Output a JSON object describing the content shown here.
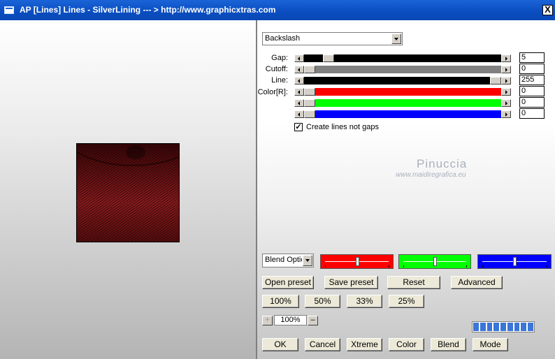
{
  "window": {
    "title": "AP [Lines]  Lines - SilverLining     --- > http://www.graphicxtras.com",
    "close_label": "X"
  },
  "mode_select": {
    "value": "Backslash"
  },
  "sliders": [
    {
      "label": "Gap:",
      "value": "5",
      "level": 0.1,
      "color": "#000000"
    },
    {
      "label": "Cutoff:",
      "value": "0",
      "level": 0.0,
      "color": "#808080"
    },
    {
      "label": "Line:",
      "value": "255",
      "level": 1.0,
      "color": "#000000"
    },
    {
      "label": "Color[R]:",
      "value": "0",
      "level": 0.0,
      "color": "#ff0000"
    },
    {
      "label": "",
      "value": "0",
      "level": 0.0,
      "color": "#00ff00"
    },
    {
      "label": "",
      "value": "0",
      "level": 0.0,
      "color": "#0000ff"
    }
  ],
  "checkbox": {
    "label": "Create lines not gaps",
    "checked": true,
    "mark": "✓"
  },
  "watermark": {
    "main": "Pinuccia",
    "sub": "www.maidiregrafica.eu"
  },
  "blend": {
    "select_value": "Blend Options",
    "channels": [
      {
        "color": "#ff0000",
        "level": 0.5
      },
      {
        "color": "#00ff00",
        "level": 0.5
      },
      {
        "color": "#0000ff",
        "level": 0.5
      }
    ]
  },
  "preset_buttons": {
    "open": "Open preset",
    "save": "Save preset",
    "reset": "Reset",
    "advanced": "Advanced"
  },
  "zoom_buttons": [
    "100%",
    "50%",
    "33%",
    "25%"
  ],
  "zoom": {
    "plus": "+",
    "value": "100%",
    "minus": "–"
  },
  "progress_segments": 9,
  "bottom_buttons": {
    "ok": "OK",
    "cancel": "Cancel",
    "xtreme": "Xtreme",
    "color": "Color",
    "blend": "Blend",
    "mode": "Mode"
  }
}
